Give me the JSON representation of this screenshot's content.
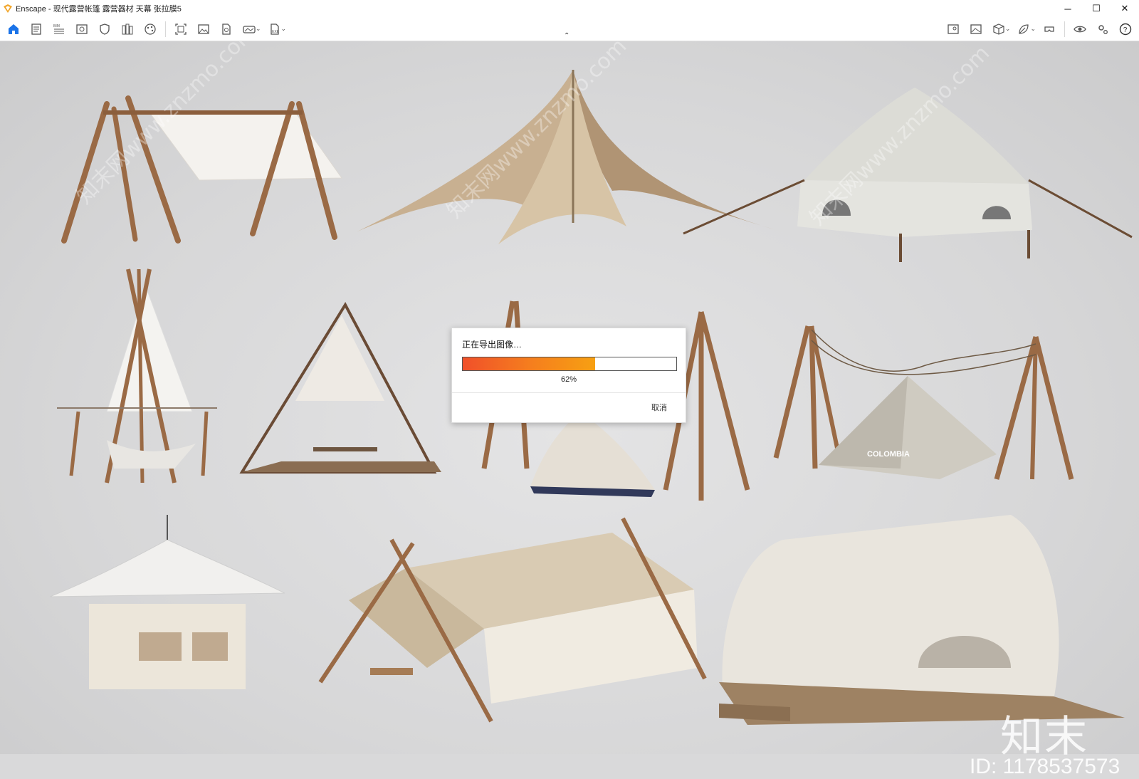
{
  "window": {
    "title": "Enscape - 现代露营帐篷 露营器材 天幕 张拉膜5",
    "minimize": "─",
    "maximize": "☐",
    "close": "✕"
  },
  "toolbar": {
    "left_icons": [
      "home-icon",
      "document-icon",
      "bim-icon",
      "view-icon",
      "shield-icon",
      "library-icon",
      "palette-icon",
      "capture-icon",
      "image-icon",
      "file-export-icon",
      "panorama-icon",
      "export-file-icon"
    ],
    "right_icons": [
      "map-icon",
      "landscape-icon",
      "cube-icon",
      "leaf-icon",
      "vr-icon",
      "eye-icon",
      "settings-icon",
      "help-icon"
    ],
    "collapse": "⌃"
  },
  "dialog": {
    "title": "正在导出图像…",
    "progress": 0.62,
    "percent_label": "62%",
    "cancel_label": "取消"
  },
  "watermark": {
    "logo": "知末",
    "id": "ID: 1178537573",
    "diagonal": "知末网www.znzmo.com"
  },
  "colors": {
    "accent": "#1a73e8",
    "progress_start": "#f0502a",
    "progress_end": "#f7a012",
    "wood": "#9a6a45",
    "canvas": "#f2f0ec"
  }
}
